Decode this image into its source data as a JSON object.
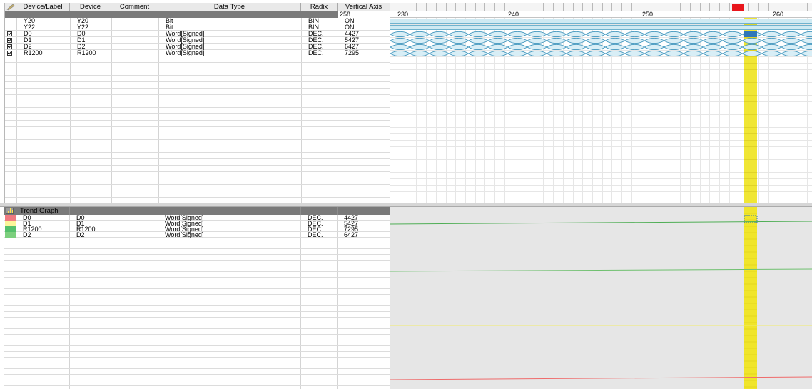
{
  "colors": {
    "cursor_flag": "#e8161c",
    "cursor_band": "#f0e52a",
    "bit_fill": "#cfeaf3",
    "word_stroke": "#3f95bd",
    "trend_bg": "#e6e6e6",
    "header_dark": "#7a7a7a"
  },
  "top_grid": {
    "columns": [
      "Device/Label",
      "Device",
      "Comment",
      "Data Type",
      "Radix",
      "Vertical Axis"
    ],
    "vertical_axis_value": "258",
    "rows": [
      {
        "checked": false,
        "label": "Y20",
        "device": "Y20",
        "comment": "",
        "data_type": "Bit",
        "radix": "BIN",
        "value": "ON",
        "kind": "bit"
      },
      {
        "checked": false,
        "label": "Y22",
        "device": "Y22",
        "comment": "",
        "data_type": "Bit",
        "radix": "BIN",
        "value": "ON",
        "kind": "bit"
      },
      {
        "checked": true,
        "label": "D0",
        "device": "D0",
        "comment": "",
        "data_type": "Word[Signed]",
        "radix": "DEC.",
        "value": "4427",
        "kind": "word"
      },
      {
        "checked": true,
        "label": "D1",
        "device": "D1",
        "comment": "",
        "data_type": "Word[Signed]",
        "radix": "DEC.",
        "value": "5427",
        "kind": "word"
      },
      {
        "checked": true,
        "label": "D2",
        "device": "D2",
        "comment": "",
        "data_type": "Word[Signed]",
        "radix": "DEC.",
        "value": "6427",
        "kind": "word"
      },
      {
        "checked": true,
        "label": "R1200",
        "device": "R1200",
        "comment": "",
        "data_type": "Word[Signed]",
        "radix": "DEC.",
        "value": "7295",
        "kind": "word"
      }
    ]
  },
  "timeline": {
    "labels": [
      "230",
      "240",
      "250",
      "260"
    ]
  },
  "trend_grid": {
    "title": "Trend Graph",
    "rows": [
      {
        "color": "#f07a80",
        "label": "D0",
        "device": "D0",
        "data_type": "Word[Signed]",
        "radix": "DEC.",
        "value": "4427"
      },
      {
        "color": "#fbf59a",
        "label": "D1",
        "device": "D1",
        "data_type": "Word[Signed]",
        "radix": "DEC.",
        "value": "5427"
      },
      {
        "color": "#55c06b",
        "label": "R1200",
        "device": "R1200",
        "data_type": "Word[Signed]",
        "radix": "DEC.",
        "value": "7295"
      },
      {
        "color": "#7ccf7e",
        "label": "D2",
        "device": "D2",
        "data_type": "Word[Signed]",
        "radix": "DEC.",
        "value": "6427"
      }
    ]
  },
  "trend_lines": [
    {
      "series": "R1200",
      "color": "#4fae55"
    },
    {
      "series": "D2",
      "color": "#6fc06f"
    },
    {
      "series": "D1",
      "color": "#f2ec6a"
    },
    {
      "series": "D0",
      "color": "#ef6b6b"
    }
  ]
}
